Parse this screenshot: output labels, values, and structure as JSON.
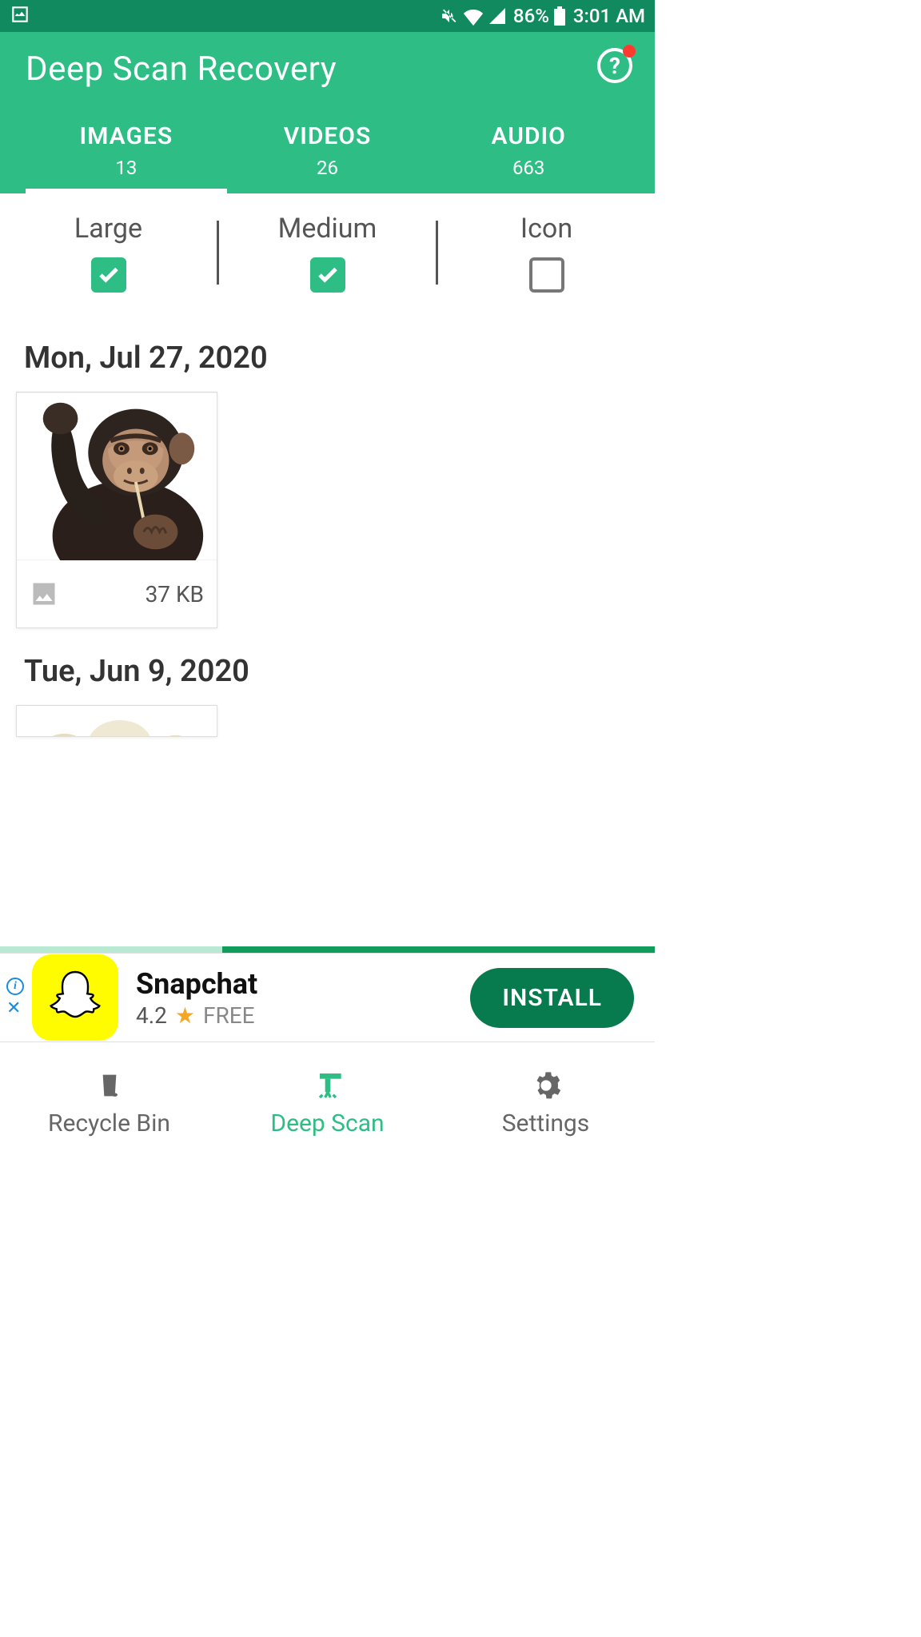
{
  "status": {
    "battery": "86%",
    "time": "3:01 AM"
  },
  "header": {
    "title": "Deep Scan Recovery"
  },
  "tabs": [
    {
      "label": "IMAGES",
      "count": "13",
      "active": true
    },
    {
      "label": "VIDEOS",
      "count": "26",
      "active": false
    },
    {
      "label": "AUDIO",
      "count": "663",
      "active": false
    }
  ],
  "sizeFilter": [
    {
      "label": "Large",
      "checked": true
    },
    {
      "label": "Medium",
      "checked": true
    },
    {
      "label": "Icon",
      "checked": false
    }
  ],
  "groups": [
    {
      "date": "Mon, Jul 27, 2020",
      "items": [
        {
          "size": "37 KB"
        }
      ]
    },
    {
      "date": "Tue, Jun 9, 2020",
      "items": []
    }
  ],
  "ad": {
    "title": "Snapchat",
    "rating": "4.2",
    "price": "FREE",
    "cta": "INSTALL"
  },
  "bottomNav": [
    {
      "label": "Recycle Bin",
      "active": false
    },
    {
      "label": "Deep Scan",
      "active": true
    },
    {
      "label": "Settings",
      "active": false
    }
  ]
}
